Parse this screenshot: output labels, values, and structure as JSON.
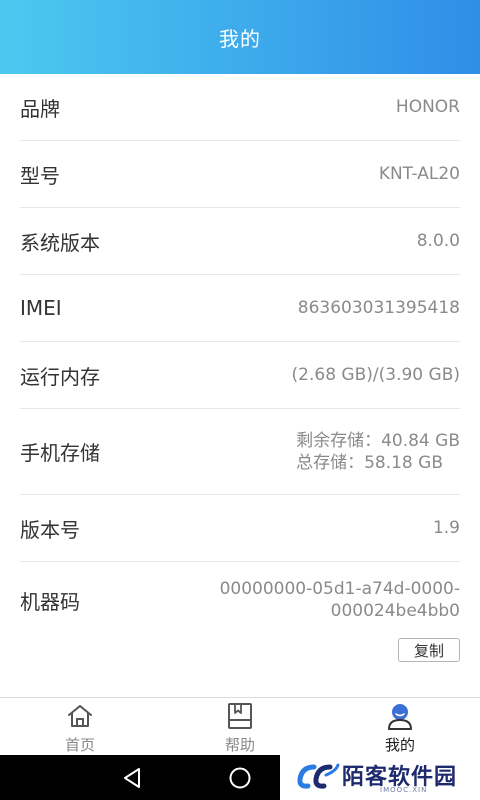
{
  "header": {
    "title": "我的"
  },
  "rows": [
    {
      "label": "品牌",
      "value": "HONOR"
    },
    {
      "label": "型号",
      "value": "KNT-AL20"
    },
    {
      "label": "系统版本",
      "value": "8.0.0"
    },
    {
      "label": "IMEI",
      "value": "863603031395418"
    },
    {
      "label": "运行内存",
      "value": "(2.68 GB)/(3.90 GB)"
    },
    {
      "label": "手机存储",
      "value_line1": "剩余存储：40.84 GB",
      "value_line2": "总存储：58.18 GB"
    },
    {
      "label": "版本号",
      "value": "1.9"
    },
    {
      "label": "机器码",
      "value_line1": "00000000-05d1-a74d-0000-",
      "value_line2": "000024be4bb0",
      "copy_label": "复制"
    }
  ],
  "tabs": [
    {
      "label": "首页",
      "icon": "home-icon",
      "active": false
    },
    {
      "label": "帮助",
      "icon": "book-icon",
      "active": false
    },
    {
      "label": "我的",
      "icon": "user-icon",
      "active": true
    }
  ],
  "nav": {
    "back_icon": "back-icon",
    "home_icon": "home-circle-icon"
  },
  "watermark": {
    "title": "陌客软件园",
    "subtitle": "IMOOC.XIN"
  },
  "colors": {
    "header_start": "#4cc9f0",
    "header_end": "#2f8ee8",
    "value_text": "#8a8a8a",
    "label_text": "#333333",
    "watermark": "#1e2a6e",
    "active_icon": "#3b6fd8"
  }
}
